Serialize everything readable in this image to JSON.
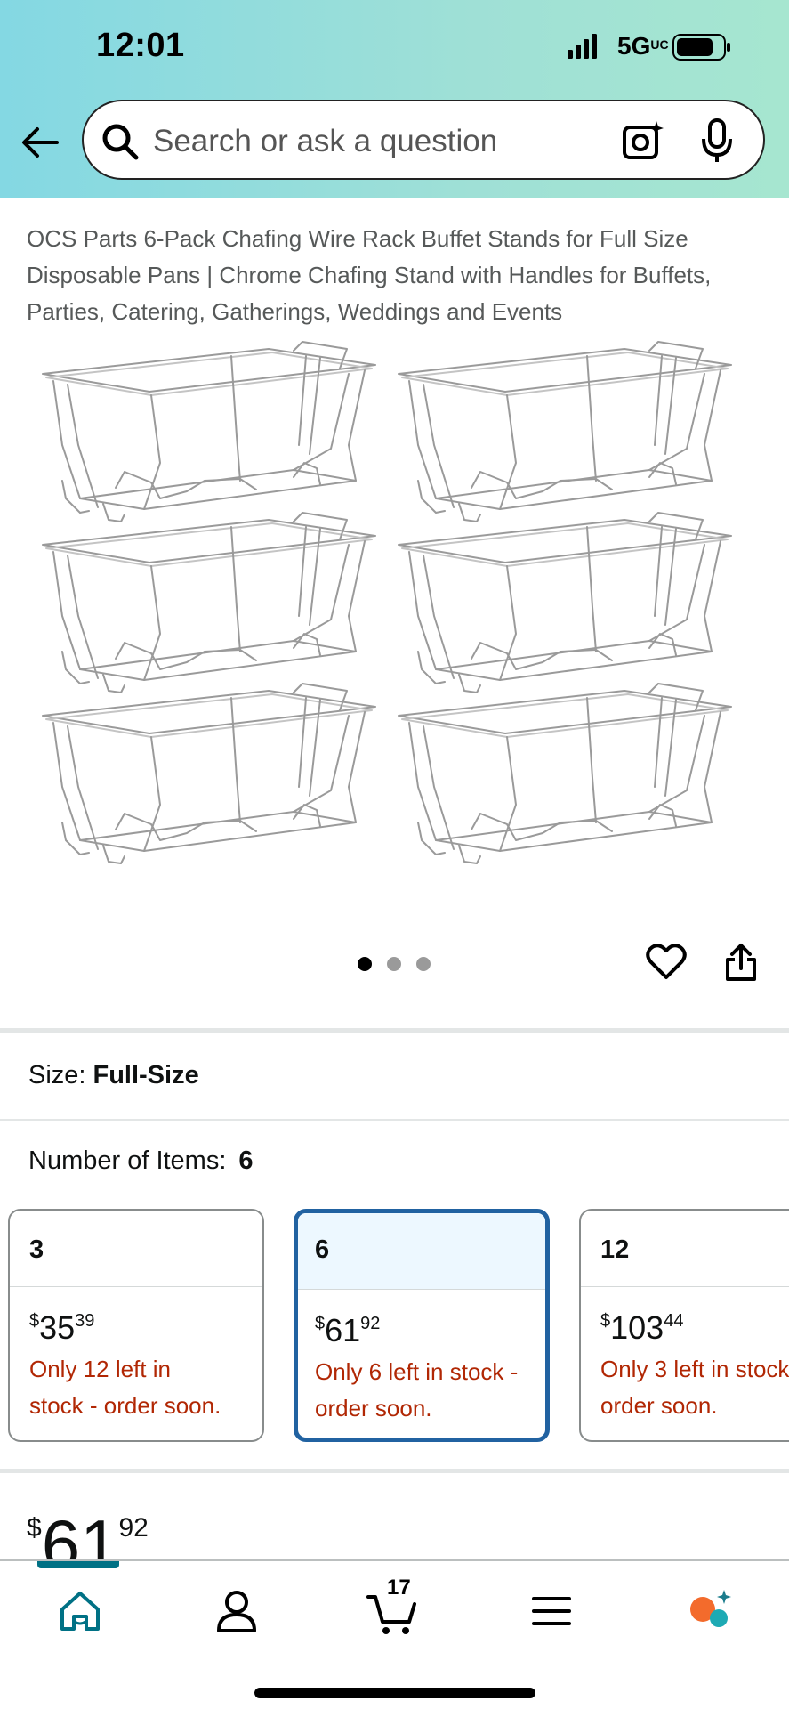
{
  "status_bar": {
    "time": "12:01",
    "network": "5G",
    "network_suffix": "UC"
  },
  "search": {
    "placeholder": "Search or ask a question"
  },
  "product": {
    "title": "OCS Parts 6-Pack Chafing Wire Rack Buffet Stands for Full Size Disposable Pans | Chrome Chafing Stand with Handles for Buffets, Parties, Catering, Gatherings, Weddings and Events",
    "image_icon": "wire-rack-image",
    "image_count": 3,
    "active_image_index": 0
  },
  "size": {
    "label": "Size:",
    "value": "Full-Size"
  },
  "number_of_items": {
    "label": "Number of Items:",
    "value": "6",
    "options": [
      {
        "qty": "3",
        "currency": "$",
        "whole": "35",
        "cents": "39",
        "stock": "Only 12 left in stock - order soon.",
        "selected": false
      },
      {
        "qty": "6",
        "currency": "$",
        "whole": "61",
        "cents": "92",
        "stock": "Only 6 left in stock - order soon.",
        "selected": true
      },
      {
        "qty": "12",
        "currency": "$",
        "whole": "103",
        "cents": "44",
        "stock": "Only 3 left in stock - order soon.",
        "selected": false
      }
    ]
  },
  "price": {
    "currency": "$",
    "whole": "61",
    "cents": "92"
  },
  "bottom_nav": {
    "items": [
      "home-icon",
      "account-icon",
      "cart-icon",
      "menu-icon",
      "rufus-icon"
    ],
    "cart_count": "17",
    "active": "home-icon"
  },
  "colors": {
    "accent": "#007185",
    "selected_border": "#2162a1",
    "stock_red": "#b12704",
    "header_start": "#84d8e3",
    "header_end": "#a6e6d0"
  }
}
